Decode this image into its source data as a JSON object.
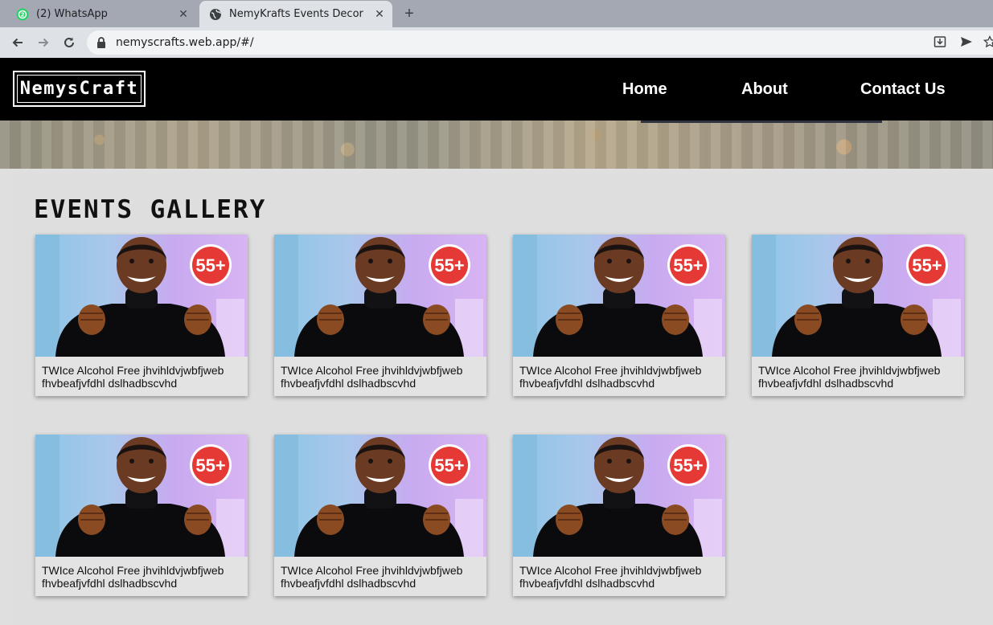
{
  "browser": {
    "tabs": [
      {
        "title": "(2) WhatsApp",
        "active": false
      },
      {
        "title": "NemyKrafts Events Decor",
        "active": true
      }
    ],
    "url": "nemyscrafts.web.app/#/"
  },
  "header": {
    "logo": "NemysCraft",
    "nav": [
      "Home",
      "About",
      "Contact Us"
    ]
  },
  "gallery": {
    "title": "EVENTS GALLERY",
    "badge": "55+",
    "items": [
      {
        "caption": "TWIce Alcohol Free jhvihldvjwbfjweb fhvbeafjvfdhl dslhadbscvhd"
      },
      {
        "caption": "TWIce Alcohol Free jhvihldvjwbfjweb fhvbeafjvfdhl dslhadbscvhd"
      },
      {
        "caption": "TWIce Alcohol Free jhvihldvjwbfjweb fhvbeafjvfdhl dslhadbscvhd"
      },
      {
        "caption": "TWIce Alcohol Free jhvihldvjwbfjweb fhvbeafjvfdhl dslhadbscvhd"
      },
      {
        "caption": "TWIce Alcohol Free jhvihldvjwbfjweb fhvbeafjvfdhl dslhadbscvhd"
      },
      {
        "caption": "TWIce Alcohol Free jhvihldvjwbfjweb fhvbeafjvfdhl dslhadbscvhd"
      },
      {
        "caption": "TWIce Alcohol Free jhvihldvjwbfjweb fhvbeafjvfdhl dslhadbscvhd"
      }
    ]
  },
  "colors": {
    "header_bg": "#000000",
    "badge": "#e53935",
    "page_bg": "#dedede"
  }
}
